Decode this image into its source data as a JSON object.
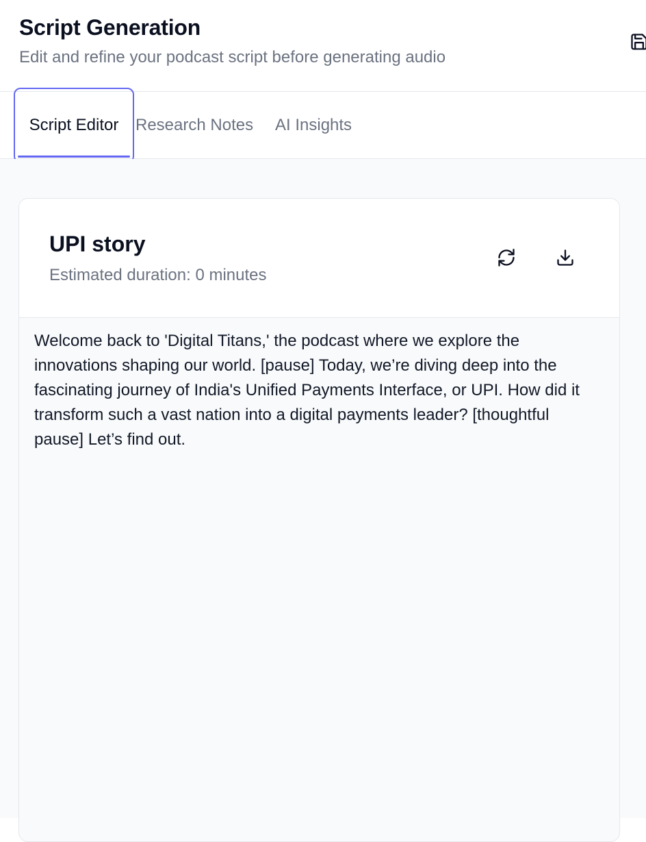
{
  "header": {
    "title": "Script Generation",
    "subtitle": "Edit and refine your podcast script before generating audio"
  },
  "tabs": [
    {
      "label": "Script Editor",
      "active": true
    },
    {
      "label": "Research Notes",
      "active": false
    },
    {
      "label": "AI Insights",
      "active": false
    }
  ],
  "card": {
    "title": "UPI story",
    "duration": "Estimated duration: 0 minutes",
    "script": "Welcome back to 'Digital Titans,' the podcast where we explore the innovations shaping our world. [pause] Today, we’re diving deep into the fascinating journey of India's Unified Payments Interface, or UPI. How did it transform such a vast nation into a digital payments leader? [thoughtful pause] Let’s find out."
  },
  "icons": {
    "save": "save-icon",
    "regenerate": "refresh-icon",
    "download": "download-icon"
  },
  "colors": {
    "accent": "#6366f1",
    "muted_text": "#6b7280",
    "page_background": "#f9fafb",
    "border": "#e5e7eb"
  }
}
